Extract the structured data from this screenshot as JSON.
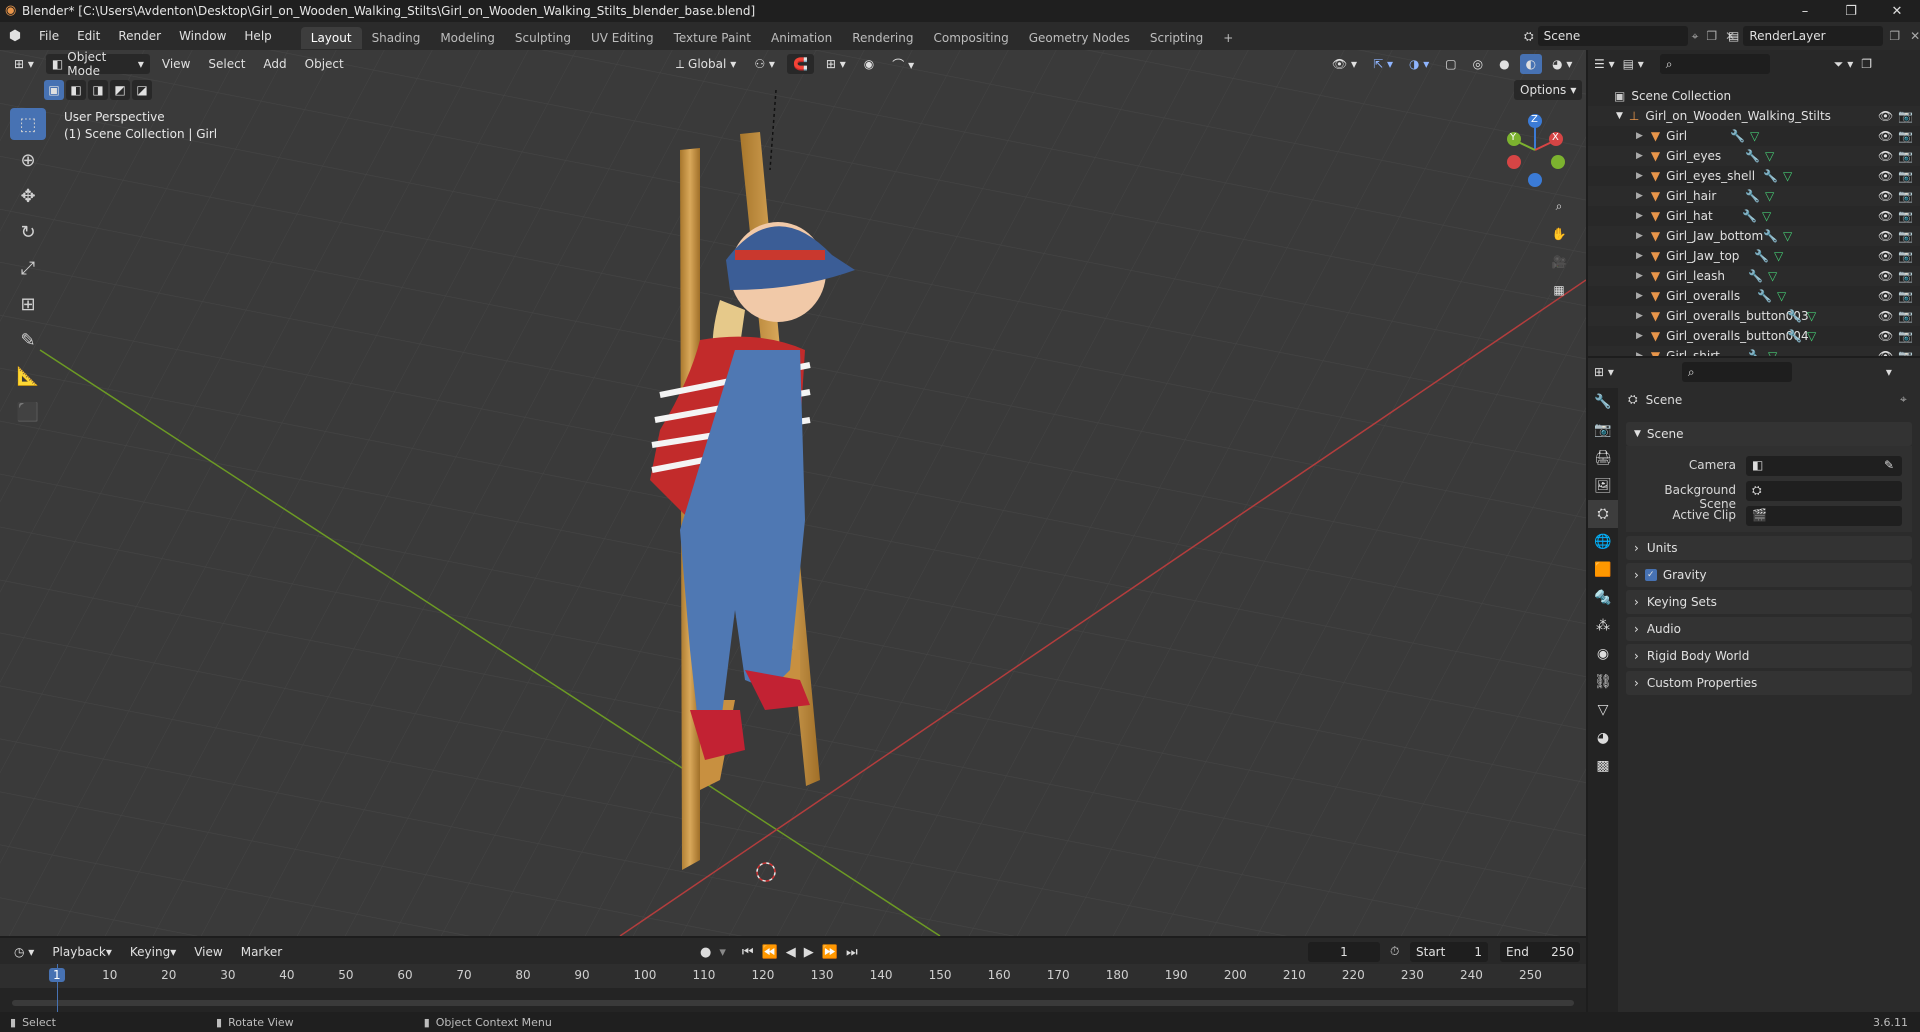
{
  "window": {
    "title": "Blender* [C:\\Users\\Avdenton\\Desktop\\Girl_on_Wooden_Walking_Stilts\\Girl_on_Wooden_Walking_Stilts_blender_base.blend]",
    "minimize": "–",
    "maximize": "❐",
    "close": "✕"
  },
  "menu": {
    "items": [
      "File",
      "Edit",
      "Render",
      "Window",
      "Help"
    ]
  },
  "workspaces": [
    "Layout",
    "Shading",
    "Modeling",
    "Sculpting",
    "UV Editing",
    "Texture Paint",
    "Animation",
    "Rendering",
    "Compositing",
    "Geometry Nodes",
    "Scripting",
    "+"
  ],
  "scene_selector": {
    "value": "Scene"
  },
  "view_layer": {
    "value": "RenderLayer"
  },
  "viewport": {
    "mode": "Object Mode",
    "menus": [
      "View",
      "Select",
      "Add",
      "Object"
    ],
    "transform_orientation": "Global",
    "options_label": "Options",
    "overlay_line1": "User Perspective",
    "overlay_line2": "(1) Scene Collection | Girl",
    "gizmo": {
      "x": "X",
      "y": "Y",
      "z": "Z"
    }
  },
  "outliner": {
    "search_placeholder": "",
    "root": "Scene Collection",
    "collection": "Girl_on_Wooden_Walking_Stilts",
    "objects": [
      "Girl",
      "Girl_eyes",
      "Girl_eyes_shell",
      "Girl_hair",
      "Girl_hat",
      "Girl_Jaw_bottom",
      "Girl_Jaw_top",
      "Girl_leash",
      "Girl_overalls",
      "Girl_overalls_button003",
      "Girl_overalls_button004",
      "Girl_shirt"
    ]
  },
  "properties": {
    "context": "Scene",
    "panel_scene": "Scene",
    "camera_label": "Camera",
    "background_scene_label": "Background Scene",
    "active_clip_label": "Active Clip",
    "panels": [
      "Units",
      "Gravity",
      "Keying Sets",
      "Audio",
      "Rigid Body World",
      "Custom Properties"
    ]
  },
  "timeline": {
    "menus": [
      "Playback",
      "Keying",
      "View",
      "Marker"
    ],
    "current_frame": "1",
    "start_label": "Start",
    "start_value": "1",
    "end_label": "End",
    "end_value": "250",
    "ticks": [
      "1",
      "10",
      "20",
      "30",
      "40",
      "50",
      "60",
      "70",
      "80",
      "90",
      "100",
      "110",
      "120",
      "130",
      "140",
      "150",
      "160",
      "170",
      "180",
      "190",
      "200",
      "210",
      "220",
      "230",
      "240",
      "250"
    ]
  },
  "status": {
    "select": "Select",
    "rotate": "Rotate View",
    "context_menu": "Object Context Menu",
    "version": "3.6.11"
  },
  "colors": {
    "accent": "#4772b3",
    "object_icon": "#e8954a",
    "axis_x": "#b33d3d",
    "axis_y": "#6c9a24"
  }
}
